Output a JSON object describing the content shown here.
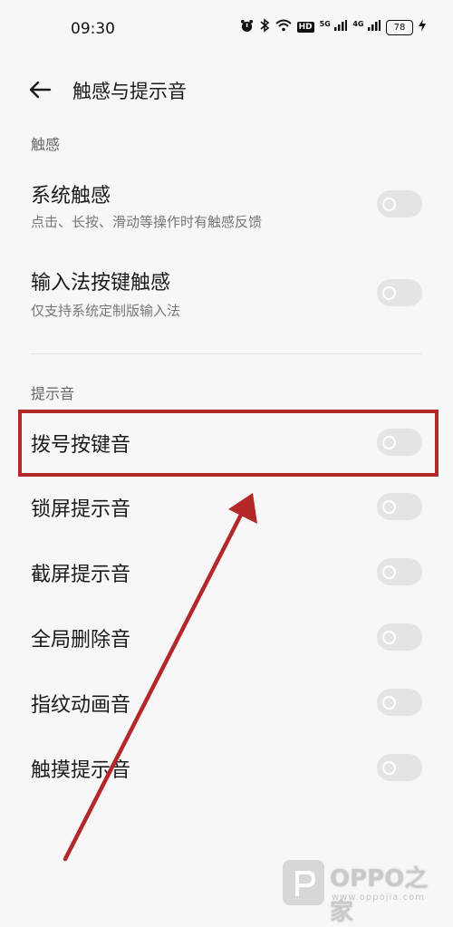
{
  "status_bar": {
    "time": "09:30",
    "signal_1": "5G",
    "signal_2": "4G",
    "hd_badge": "HD",
    "battery": "78"
  },
  "header": {
    "title": "触感与提示音"
  },
  "sections": {
    "haptics": {
      "title": "触感",
      "items": [
        {
          "label": "系统触感",
          "subtitle": "点击、长按、滑动等操作时有触感反馈",
          "enabled": false
        },
        {
          "label": "输入法按键触感",
          "subtitle": "仅支持系统定制版输入法",
          "enabled": false
        }
      ]
    },
    "sounds": {
      "title": "提示音",
      "items": [
        {
          "label": "拨号按键音",
          "enabled": false
        },
        {
          "label": "锁屏提示音",
          "enabled": false
        },
        {
          "label": "截屏提示音",
          "enabled": false
        },
        {
          "label": "全局删除音",
          "enabled": false
        },
        {
          "label": "指纹动画音",
          "enabled": false
        },
        {
          "label": "触摸提示音",
          "enabled": false
        }
      ]
    }
  },
  "annotation": {
    "color": "#b5282a"
  },
  "watermark": {
    "brand": "OPPO之家",
    "url": "www.oppojia.com"
  }
}
